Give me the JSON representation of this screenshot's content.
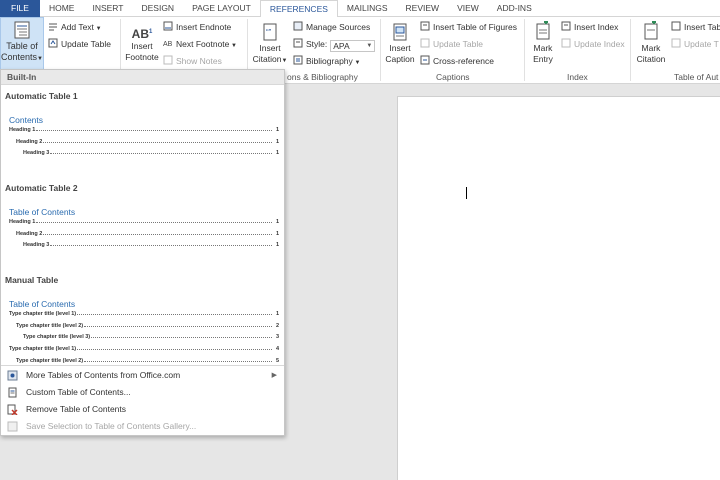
{
  "tabs": [
    {
      "label": "FILE"
    },
    {
      "label": "HOME"
    },
    {
      "label": "INSERT"
    },
    {
      "label": "DESIGN"
    },
    {
      "label": "PAGE LAYOUT"
    },
    {
      "label": "REFERENCES"
    },
    {
      "label": "MAILINGS"
    },
    {
      "label": "REVIEW"
    },
    {
      "label": "VIEW"
    },
    {
      "label": "ADD-INS"
    }
  ],
  "active_tab": "REFERENCES",
  "ribbon": {
    "toc_line1": "Table of",
    "toc_line2": "Contents",
    "add_text": "Add Text",
    "update_table": "Update Table",
    "insert_footnote_line1": "Insert",
    "insert_footnote_line2": "Footnote",
    "insert_endnote": "Insert Endnote",
    "next_footnote": "Next Footnote",
    "show_notes": "Show Notes",
    "insert_citation_line1": "Insert",
    "insert_citation_line2": "Citation",
    "manage_sources": "Manage Sources",
    "style_label": "Style:",
    "style_value": "APA",
    "bibliography": "Bibliography",
    "citations_group": "ons & Bibliography",
    "insert_caption_line1": "Insert",
    "insert_caption_line2": "Caption",
    "insert_table_of_figures": "Insert Table of Figures",
    "update_table_captions": "Update Table",
    "cross_reference": "Cross-reference",
    "captions_group": "Captions",
    "mark_entry_line1": "Mark",
    "mark_entry_line2": "Entry",
    "insert_index": "Insert Index",
    "update_index": "Update Index",
    "index_group": "Index",
    "mark_citation_line1": "Mark",
    "mark_citation_line2": "Citation",
    "insert_table_auth": "Insert Tab",
    "update_table_auth": "Update T",
    "toa_group": "Table of Aut",
    "icon_ab": "AB"
  },
  "dropdown": {
    "header": "Built-In",
    "galleries": [
      {
        "title": "Automatic Table 1",
        "heading": "Contents",
        "rows": [
          {
            "text": "Heading 1",
            "page": "1",
            "indent": 0
          },
          {
            "text": "Heading 2",
            "page": "1",
            "indent": 1
          },
          {
            "text": "Heading 3",
            "page": "1",
            "indent": 2
          }
        ]
      },
      {
        "title": "Automatic Table 2",
        "heading": "Table of Contents",
        "rows": [
          {
            "text": "Heading 1",
            "page": "1",
            "indent": 0
          },
          {
            "text": "Heading 2",
            "page": "1",
            "indent": 1
          },
          {
            "text": "Heading 3",
            "page": "1",
            "indent": 2
          }
        ]
      },
      {
        "title": "Manual Table",
        "heading": "Table of Contents",
        "rows": [
          {
            "text": "Type chapter title (level 1)",
            "page": "1",
            "indent": 0
          },
          {
            "text": "Type chapter title (level 2)",
            "page": "2",
            "indent": 1
          },
          {
            "text": "Type chapter title (level 3)",
            "page": "3",
            "indent": 2
          },
          {
            "text": "Type chapter title (level 1)",
            "page": "4",
            "indent": 0
          },
          {
            "text": "Type chapter title (level 2)",
            "page": "5",
            "indent": 1
          }
        ]
      }
    ],
    "menu": [
      {
        "label": "More Tables of Contents from Office.com",
        "icon": "office-icon",
        "submenu": true,
        "disabled": false
      },
      {
        "label": "Custom Table of Contents...",
        "icon": "document-icon",
        "submenu": false,
        "disabled": false
      },
      {
        "label": "Remove Table of Contents",
        "icon": "remove-icon",
        "submenu": false,
        "disabled": false
      },
      {
        "label": "Save Selection to Table of Contents Gallery...",
        "icon": "save-icon",
        "submenu": false,
        "disabled": true
      }
    ]
  },
  "colors": {
    "accent": "#2b579a",
    "heading_blue": "#2b6cb0",
    "toc_button_bg": "#cfe3f6",
    "remove_red": "#c0392b"
  }
}
